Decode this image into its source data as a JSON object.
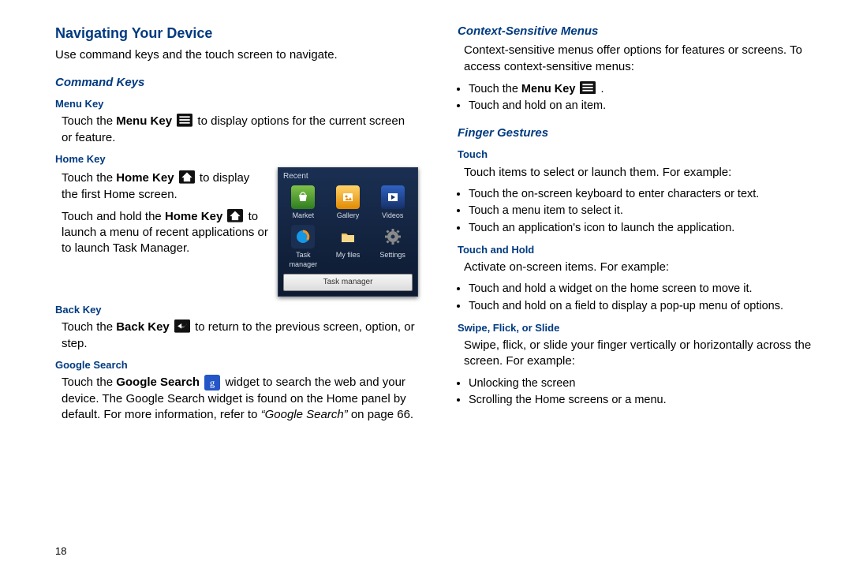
{
  "pageNumber": "18",
  "left": {
    "title": "Navigating Your Device",
    "intro": "Use command keys and the touch screen to navigate.",
    "commandKeys": "Command Keys",
    "menuKey": {
      "heading": "Menu Key",
      "pre": "Touch the ",
      "bold": "Menu Key",
      "post": " to display options for the current screen or feature."
    },
    "homeKey": {
      "heading": "Home Key",
      "p1_pre": "Touch the ",
      "p1_bold": "Home Key",
      "p1_post": " to display the first Home screen.",
      "p2_pre": "Touch and hold the ",
      "p2_bold": "Home Key",
      "p2_post": " to launch a menu of recent applications or to launch Task Manager."
    },
    "backKey": {
      "heading": "Back Key",
      "pre": "Touch the ",
      "bold": "Back Key",
      "post": " to return to the previous screen, option, or step."
    },
    "googleSearch": {
      "heading": "Google Search",
      "pre": "Touch the ",
      "bold": "Google Search",
      "mid": " widget to search the web and your device. The Google Search widget is found on the Home panel by default. For more information, refer to ",
      "ital": "“Google Search”",
      "post": " on page 66."
    }
  },
  "recent": {
    "header": "Recent",
    "tiles": [
      "Market",
      "Gallery",
      "Videos",
      "Task manager",
      "My files",
      "Settings"
    ],
    "button": "Task manager"
  },
  "right": {
    "context": {
      "heading": "Context-Sensitive Menus",
      "intro": "Context-sensitive menus offer options for features or screens. To access context-sensitive menus:",
      "b1_pre": "Touch the ",
      "b1_bold": "Menu Key",
      "b1_post": " .",
      "b2": "Touch and hold on an item."
    },
    "fingerGestures": "Finger Gestures",
    "touch": {
      "heading": "Touch",
      "intro": "Touch items to select or launch them. For example:",
      "b1": "Touch the on-screen keyboard to enter characters or text.",
      "b2": "Touch a menu item to select it.",
      "b3": "Touch an application's icon to launch the application."
    },
    "touchHold": {
      "heading": "Touch and Hold",
      "intro": "Activate on-screen items. For example:",
      "b1": "Touch and hold a widget on the home screen to move it.",
      "b2": "Touch and hold on a field to display a pop-up menu of options."
    },
    "swipe": {
      "heading": "Swipe, Flick, or Slide",
      "intro": "Swipe, flick, or slide your finger vertically or horizontally across the screen. For example:",
      "b1": "Unlocking the screen",
      "b2": "Scrolling the Home screens or a menu."
    }
  }
}
